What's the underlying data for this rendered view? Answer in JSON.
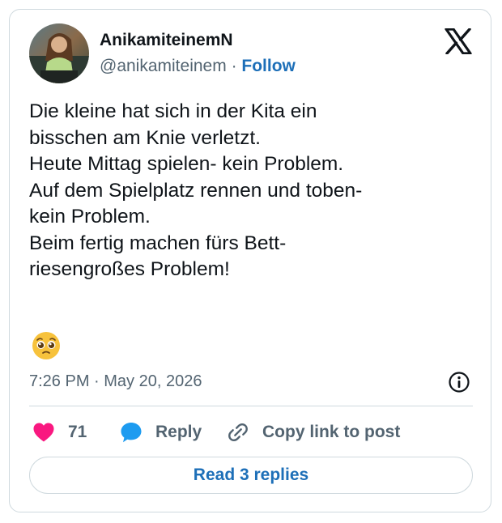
{
  "author": {
    "display_name": "AnikamiteinemN",
    "handle": "@anikamiteinem",
    "separator": "·",
    "follow_label": "Follow"
  },
  "tweet": {
    "text": "Die kleine hat sich in der Kita ein\nbisschen am Knie verletzt.\nHeute Mittag spielen- kein Problem.\nAuf dem Spielplatz rennen und toben-\nkein Problem.\nBeim fertig machen fürs Bett-\nriesengroßes Problem!",
    "emoji": "pleading-face",
    "timestamp": "7:26 PM · May 20, 2026"
  },
  "actions": {
    "like_count": "71",
    "reply_label": "Reply",
    "copy_label": "Copy link to post"
  },
  "footer": {
    "read_replies_label": "Read 3 replies"
  },
  "icons": {
    "logo": "x-logo-icon",
    "info": "info-icon",
    "like": "heart-icon",
    "reply": "speech-bubble-icon",
    "copy": "link-icon"
  },
  "colors": {
    "text": "#0f1419",
    "secondary": "#536471",
    "link": "#1d6fb8",
    "like": "#f91880",
    "reply": "#1d9bf0",
    "border": "#cfd9de"
  }
}
